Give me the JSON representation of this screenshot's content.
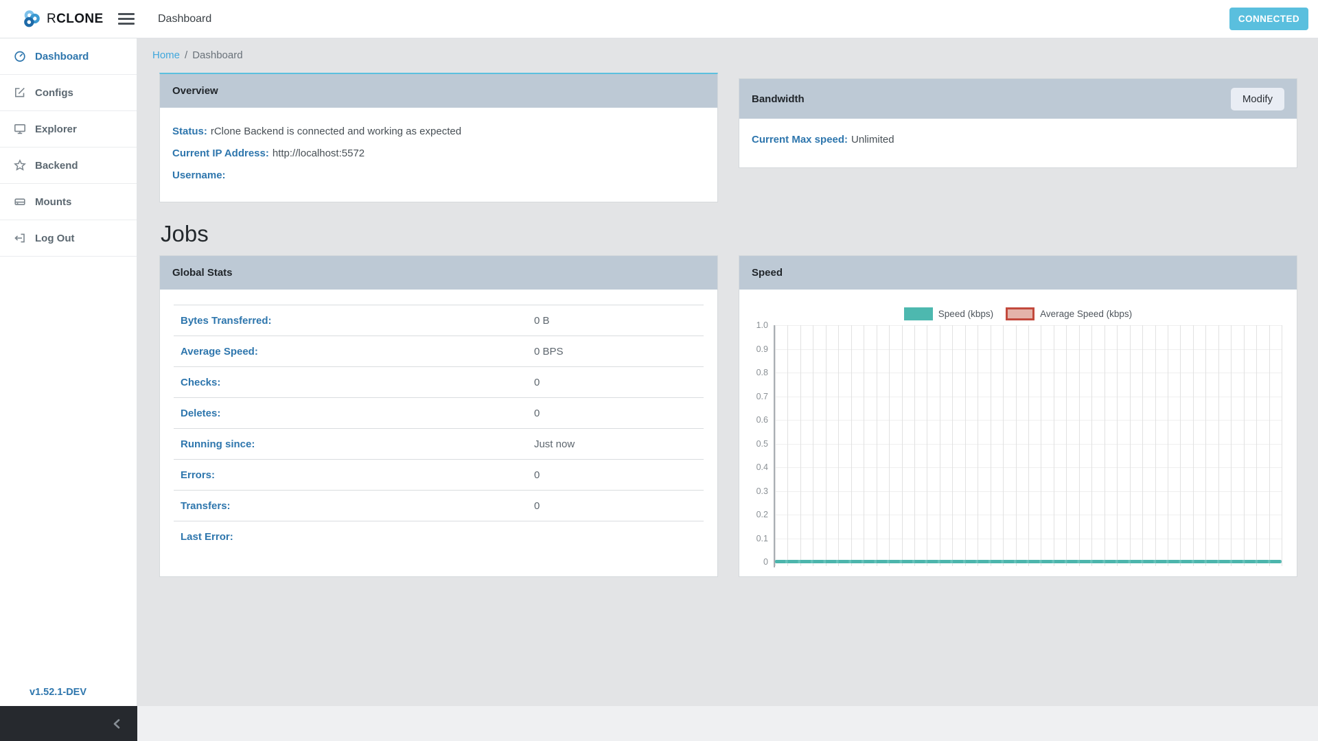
{
  "header": {
    "brand_r": "R",
    "brand_rest": "CLONE",
    "title": "Dashboard",
    "status_button": "CONNECTED"
  },
  "sidebar": {
    "items": [
      {
        "label": "Dashboard",
        "icon": "tachometer-icon",
        "active": true
      },
      {
        "label": "Configs",
        "icon": "edit-square-icon",
        "active": false
      },
      {
        "label": "Explorer",
        "icon": "monitor-icon",
        "active": false
      },
      {
        "label": "Backend",
        "icon": "star-icon",
        "active": false
      },
      {
        "label": "Mounts",
        "icon": "hard-drive-icon",
        "active": false
      },
      {
        "label": "Log Out",
        "icon": "sign-out-icon",
        "active": false
      }
    ],
    "version": "v1.52.1-DEV"
  },
  "breadcrumb": {
    "home": "Home",
    "separator": "/",
    "current": "Dashboard"
  },
  "overview_card": {
    "title": "Overview",
    "rows": [
      {
        "label": "Status:",
        "value": "rClone Backend is connected and working as expected"
      },
      {
        "label": "Current IP Address:",
        "value": "http://localhost:5572"
      },
      {
        "label": "Username:",
        "value": ""
      }
    ]
  },
  "bandwidth_card": {
    "title": "Bandwidth",
    "modify_label": "Modify",
    "rows": [
      {
        "label": "Current Max speed:",
        "value": "Unlimited"
      }
    ]
  },
  "jobs": {
    "heading": "Jobs"
  },
  "global_stats_card": {
    "title": "Global Stats",
    "rows": [
      {
        "label": "Bytes Transferred:",
        "value": "0 B"
      },
      {
        "label": "Average Speed:",
        "value": "0 BPS"
      },
      {
        "label": "Checks:",
        "value": "0"
      },
      {
        "label": "Deletes:",
        "value": "0"
      },
      {
        "label": "Running since:",
        "value": "Just now"
      },
      {
        "label": "Errors:",
        "value": "0"
      },
      {
        "label": "Transfers:",
        "value": "0"
      },
      {
        "label": "Last Error:",
        "value": ""
      }
    ]
  },
  "speed_card": {
    "title": "Speed"
  },
  "chart_data": {
    "type": "line",
    "title": "Speed",
    "legend_position": "top-center",
    "grid": true,
    "x_axis": {
      "label": "",
      "tick_labels_visible": false,
      "gridline_count": 41
    },
    "y_axis": {
      "label": "",
      "min": 0,
      "max": 1.0,
      "tick_step": 0.1,
      "tick_labels": [
        "1.0",
        "0.9",
        "0.8",
        "0.7",
        "0.6",
        "0.5",
        "0.4",
        "0.3",
        "0.2",
        "0.1",
        "0"
      ]
    },
    "series": [
      {
        "name": "Speed (kbps)",
        "color": "#4db8af",
        "style": "filled",
        "constant_value": 0
      },
      {
        "name": "Average Speed (kbps)",
        "color": "#c2493c",
        "fill": "#e4b3aa",
        "style": "outlined",
        "constant_value": 0
      }
    ]
  },
  "colors": {
    "accent_info": "#5bc0de",
    "card_header_bg": "#bdc9d5",
    "label_blue": "#2e76ad",
    "breadcrumb_link": "#41a7dc",
    "connected_button_bg": "#5abfde",
    "speed_series": "#4db8af",
    "average_series_border": "#c2493c",
    "average_series_fill": "#e4b3aa",
    "dark_footer_bg": "#26292e",
    "page_bg": "#e3e4e6"
  }
}
